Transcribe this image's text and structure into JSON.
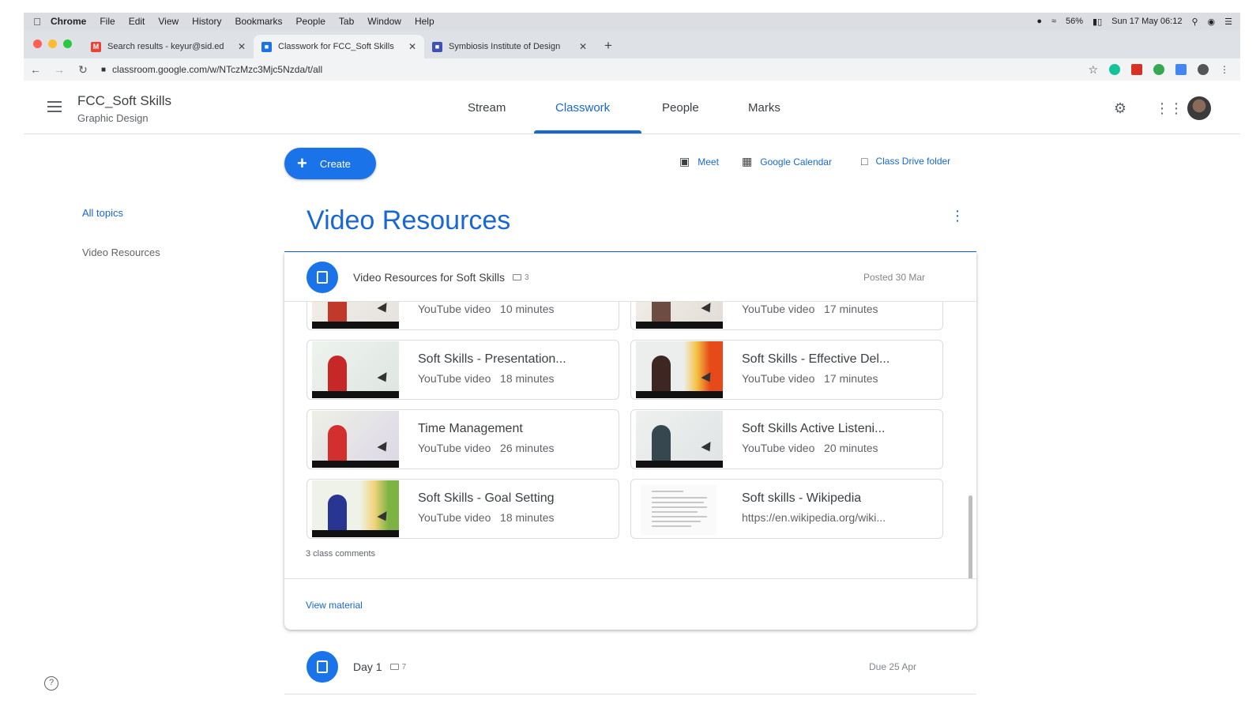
{
  "macos": {
    "menu": [
      "Chrome",
      "File",
      "Edit",
      "View",
      "History",
      "Bookmarks",
      "People",
      "Tab",
      "Window",
      "Help"
    ],
    "battery": "56%",
    "datetime": "Sun 17 May 06:12"
  },
  "browser": {
    "tabs": [
      {
        "title": "Search results - keyur@sid.ed",
        "favicon": "gmail-icon"
      },
      {
        "title": "Classwork for FCC_Soft Skills",
        "favicon": "classroom-icon"
      },
      {
        "title": "Symbiosis Institute of Design",
        "favicon": "site-icon"
      }
    ],
    "url": "classroom.google.com/w/NTczMzc3Mjc5Nzda/t/all"
  },
  "classroom": {
    "class_name": "FCC_Soft Skills",
    "section": "Graphic Design",
    "nav": [
      "Stream",
      "Classwork",
      "People",
      "Marks"
    ],
    "active_nav": "Classwork"
  },
  "toolbar": {
    "create_label": "Create",
    "meet_label": "Meet",
    "calendar_label": "Google Calendar",
    "drive_label": "Class Drive folder"
  },
  "topics": {
    "all_label": "All topics",
    "items": [
      "Video Resources"
    ]
  },
  "section": {
    "title": "Video Resources"
  },
  "material": {
    "title": "Video Resources for Soft Skills",
    "comment_count": "3",
    "posted": "Posted 30 Mar",
    "attachments": [
      {
        "title": "",
        "type": "YouTube video",
        "duration": "10 minutes"
      },
      {
        "title": "",
        "type": "YouTube video",
        "duration": "17 minutes"
      },
      {
        "title": "Soft Skills - Presentation...",
        "type": "YouTube video",
        "duration": "18 minutes"
      },
      {
        "title": "Soft Skills - Effective Del...",
        "type": "YouTube video",
        "duration": "17 minutes"
      },
      {
        "title": "Time Management",
        "type": "YouTube video",
        "duration": "26 minutes"
      },
      {
        "title": "Soft Skills Active Listeni...",
        "type": "YouTube video",
        "duration": "20 minutes"
      },
      {
        "title": "Soft Skills - Goal Setting",
        "type": "YouTube video",
        "duration": "18 minutes"
      },
      {
        "title": "Soft skills - Wikipedia",
        "type": "https://en.wikipedia.org/wiki...",
        "duration": ""
      }
    ],
    "class_comments": "3 class comments",
    "view_label": "View material"
  },
  "next_item": {
    "title": "Day 1",
    "comment_count": "7",
    "due": "Due 25 Apr"
  },
  "colors": {
    "accent": "#1967d2",
    "button": "#1a73e8"
  }
}
